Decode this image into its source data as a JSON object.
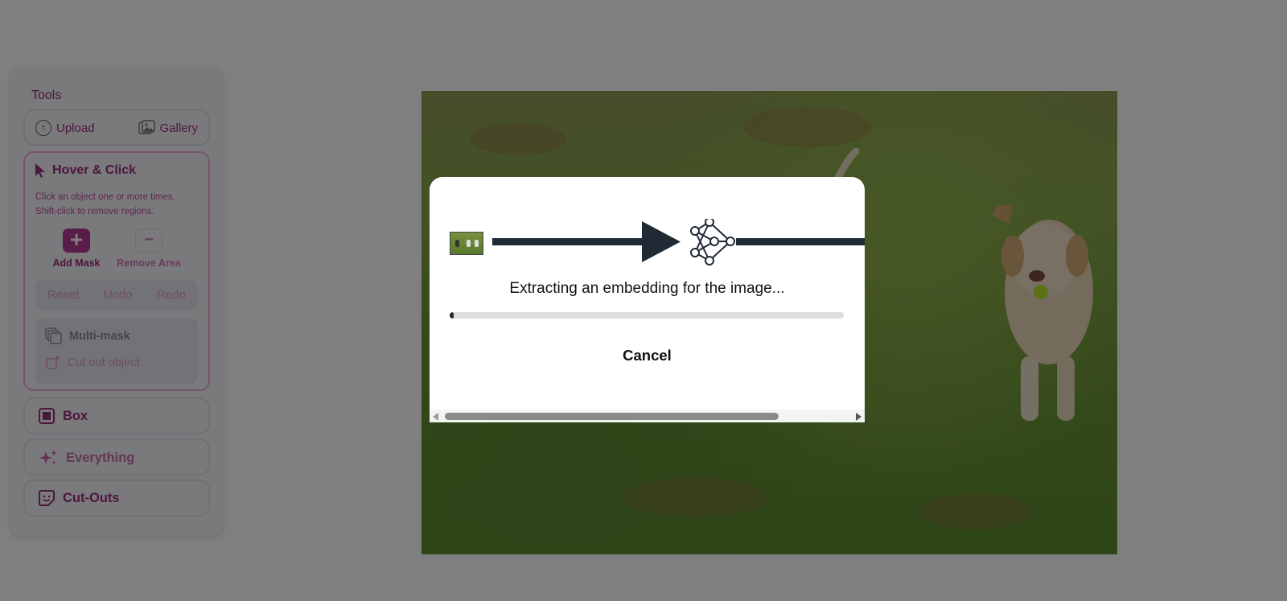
{
  "sidebar": {
    "tools_title": "Tools",
    "upload_label": "Upload",
    "gallery_label": "Gallery",
    "hover_click": {
      "title": "Hover & Click",
      "description_line1": "Click an object one or more times.",
      "description_line2": "Shift-click to remove regions.",
      "add_mask_label": "Add Mask",
      "remove_area_label": "Remove Area",
      "reset_label": "Reset",
      "undo_label": "Undo",
      "redo_label": "Redo",
      "multi_mask_label": "Multi-mask",
      "cut_out_label": "Cut out object"
    },
    "box_label": "Box",
    "everything_label": "Everything",
    "cutouts_label": "Cut-Outs"
  },
  "modal": {
    "message": "Extracting an embedding for the image...",
    "progress": 0.01,
    "cancel_label": "Cancel"
  },
  "colors": {
    "accent": "#9b2c7b",
    "accent_light": "#dc99c6",
    "overlay": "rgba(0,0,0,0.5)",
    "arrow": "#1f2a35"
  },
  "icons": {
    "upload": "arrow-up-circle-icon",
    "gallery": "gallery-icon",
    "hover": "cursor-icon",
    "multi_mask": "stacked-squares-icon",
    "cut_out": "cut-out-icon",
    "box": "box-icon",
    "everything": "sparkles-icon",
    "cutouts": "sticker-icon"
  }
}
